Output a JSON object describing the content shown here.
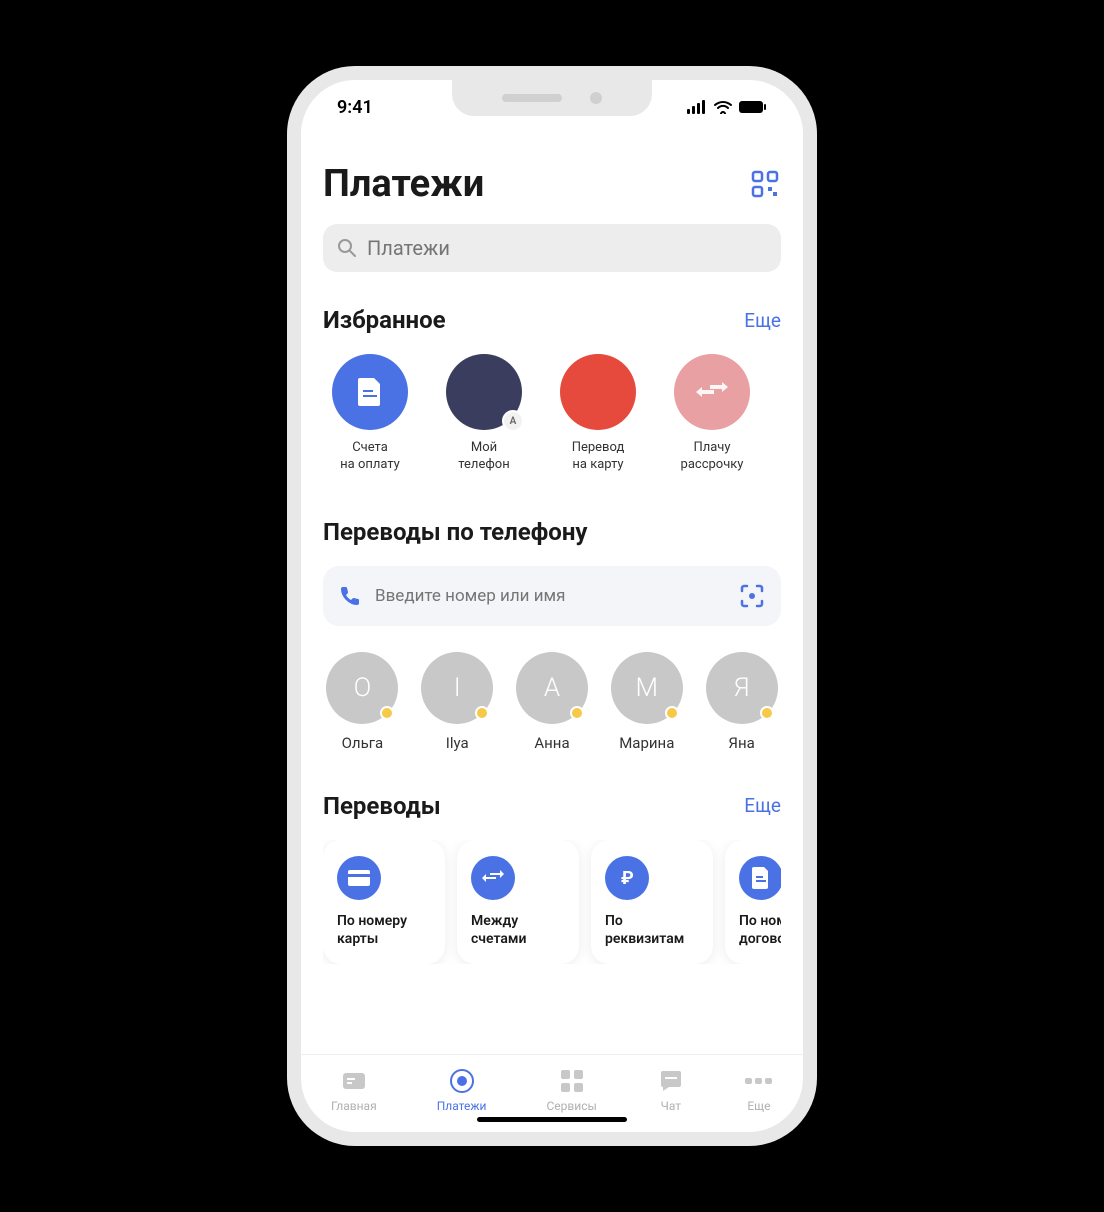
{
  "status": {
    "time": "9:41"
  },
  "header": {
    "title": "Платежи",
    "search_placeholder": "Платежи"
  },
  "favorites": {
    "title": "Избранное",
    "more": "Еще",
    "items": [
      {
        "label": "Счета\nна оплату",
        "color": "blue",
        "icon": "file",
        "badge": ""
      },
      {
        "label": "Мой\nтелефон",
        "color": "navy",
        "icon": "",
        "badge": "А"
      },
      {
        "label": "Перевод\nна карту",
        "color": "red",
        "icon": "",
        "badge": ""
      },
      {
        "label": "Плачу\nрассрочку",
        "color": "pink",
        "icon": "transfer",
        "badge": ""
      }
    ]
  },
  "phone_transfers": {
    "title": "Переводы по телефону",
    "input_placeholder": "Введите номер или имя",
    "contacts": [
      {
        "initial": "О",
        "name": "Ольга"
      },
      {
        "initial": "I",
        "name": "Ilya"
      },
      {
        "initial": "А",
        "name": "Анна"
      },
      {
        "initial": "М",
        "name": "Марина"
      },
      {
        "initial": "Я",
        "name": "Яна"
      }
    ]
  },
  "transfers": {
    "title": "Переводы",
    "more": "Еще",
    "items": [
      {
        "label": "По номеру\nкарты",
        "icon": "card"
      },
      {
        "label": "Между\nсчетами",
        "icon": "exchange"
      },
      {
        "label": "По\nреквизитам",
        "icon": "ruble"
      },
      {
        "label": "По номер\nдоговора",
        "icon": "doc"
      }
    ]
  },
  "tabs": [
    {
      "label": "Главная",
      "icon": "home",
      "active": false
    },
    {
      "label": "Платежи",
      "icon": "payments",
      "active": true
    },
    {
      "label": "Сервисы",
      "icon": "services",
      "active": false
    },
    {
      "label": "Чат",
      "icon": "chat",
      "active": false
    },
    {
      "label": "Еще",
      "icon": "more",
      "active": false
    }
  ]
}
